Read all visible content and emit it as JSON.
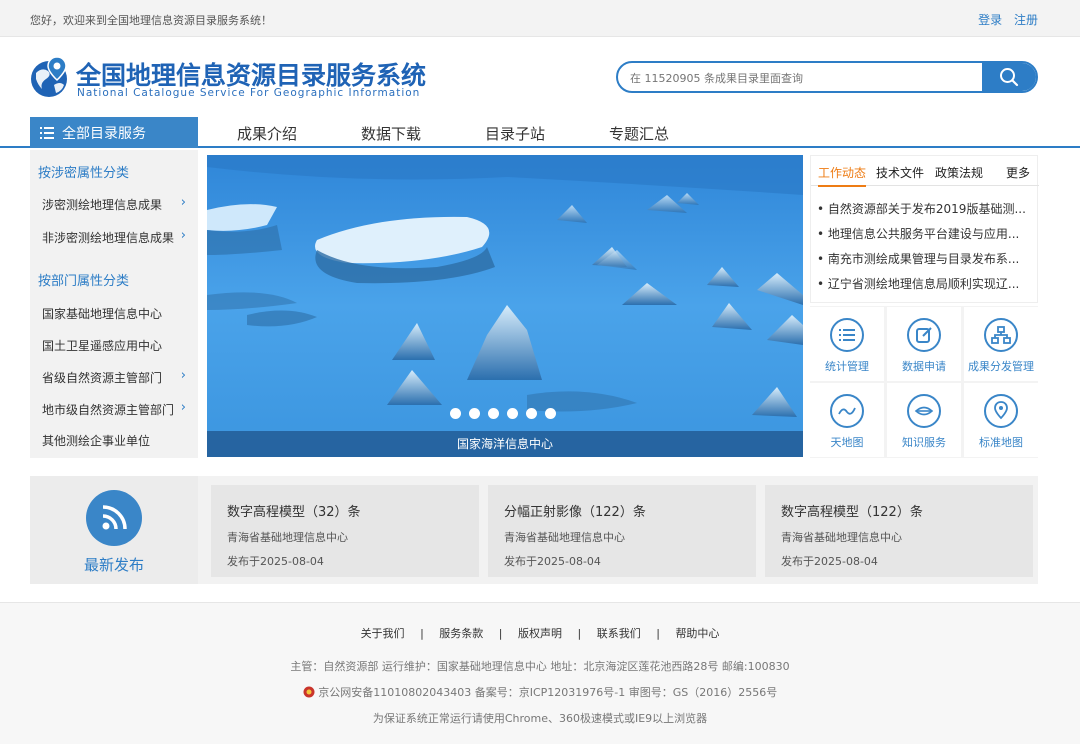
{
  "topbar": {
    "welcome": "您好，欢迎来到全国地理信息资源目录服务系统！",
    "login": "登录",
    "register": "注册"
  },
  "header": {
    "title": "全国地理信息资源目录服务系统",
    "subtitle": "National Catalogue Service For Geographic Information",
    "search_placeholder": "在 11520905 条成果目录里面查询"
  },
  "nav": {
    "all": "全部目录服务",
    "items": [
      "成果介绍",
      "数据下载",
      "目录子站",
      "专题汇总"
    ]
  },
  "sidebar": {
    "group1_title": "按涉密属性分类",
    "group1": [
      "涉密测绘地理信息成果",
      "非涉密测绘地理信息成果"
    ],
    "group2_title": "按部门属性分类",
    "group2": [
      "国家基础地理信息中心",
      "国土卫星遥感应用中心",
      "省级自然资源主管部门",
      "地市级自然资源主管部门",
      "其他测绘企事业单位"
    ]
  },
  "banner": {
    "caption": "国家海洋信息中心",
    "active_slide": 1,
    "slide_count": 6
  },
  "news": {
    "tabs": [
      "工作动态",
      "技术文件",
      "政策法规"
    ],
    "more": "更多",
    "items": [
      "自然资源部关于发布2019版基础测...",
      "地理信息公共服务平台建设与应用...",
      "南充市测绘成果管理与目录发布系...",
      "辽宁省测绘地理信息局顺利实现辽..."
    ]
  },
  "quick": {
    "items": [
      "统计管理",
      "数据申请",
      "成果分发管理",
      "天地图",
      "知识服务",
      "标准地图"
    ]
  },
  "latest": {
    "label": "最新发布",
    "cards": [
      {
        "title": "数字高程模型（32）条",
        "org": "青海省基础地理信息中心",
        "date": "发布于2025-08-04"
      },
      {
        "title": "分幅正射影像（122）条",
        "org": "青海省基础地理信息中心",
        "date": "发布于2025-08-04"
      },
      {
        "title": "数字高程模型（122）条",
        "org": "青海省基础地理信息中心",
        "date": "发布于2025-08-04"
      }
    ]
  },
  "footer": {
    "links": [
      "关于我们",
      "服务条款",
      "版权声明",
      "联系我们",
      "帮助中心"
    ],
    "separator": "|",
    "line1": "主管：自然资源部 运行维护：国家基础地理信息中心 地址：北京海淀区莲花池西路28号 邮编:100830",
    "line2": "京公网安备11010802043403 备案号：京ICP12031976号-1 审图号：GS（2016）2556号",
    "line3": "为保证系统正常运行请使用Chrome、360极速模式或IE9以上浏览器"
  },
  "colors": {
    "brand_blue": "#2d7dc6",
    "nav_blue": "#3a86c8",
    "accent_orange": "#ee7c14"
  }
}
